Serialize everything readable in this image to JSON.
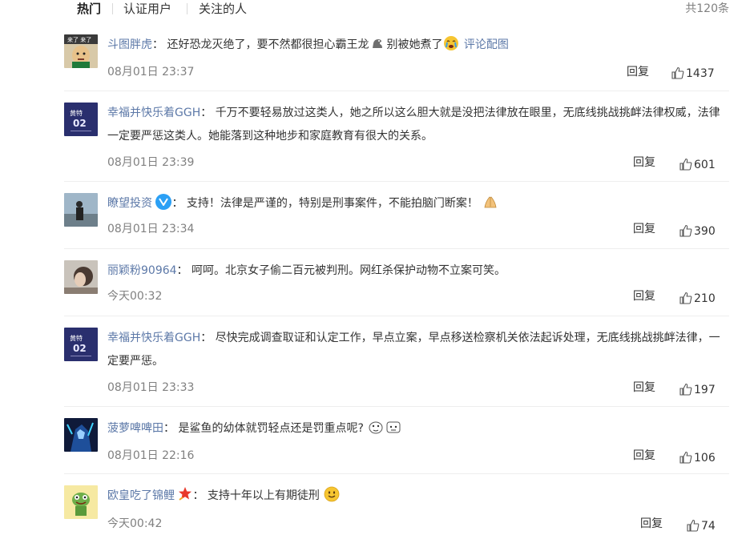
{
  "tabs": [
    {
      "label": "热门"
    },
    {
      "label": "认证用户"
    },
    {
      "label": "关注的人"
    }
  ],
  "total_count": "共120条",
  "reply_label": "回复",
  "comments": [
    {
      "user": "斗图胖虎",
      "colon": "：",
      "text": "还好恐龙灭绝了，要不然都很担心霸王龙",
      "text2": "别被她煮了",
      "extra_link": "评论配图",
      "time": "08月01日 23:37",
      "likes": "1437"
    },
    {
      "user": "幸福并快乐着GGH",
      "colon": "：",
      "text": "千万不要轻易放过这类人，她之所以这么胆大就是没把法律放在眼里，无底线挑战挑衅法律权威，法律一定要严惩这类人。她能落到这种地步和家庭教育有很大的关系。",
      "time": "08月01日 23:39",
      "likes": "601"
    },
    {
      "user": "瞭望投资",
      "colon": "：",
      "text": "支持！法律是严谨的，特别是刑事案件，不能拍脑门断案！",
      "time": "08月01日 23:34",
      "likes": "390"
    },
    {
      "user": "丽颖粉90964",
      "colon": "：",
      "text": "呵呵。北京女子偷二百元被判刑。网红杀保护动物不立案可笑。",
      "time": "今天00:32",
      "likes": "210"
    },
    {
      "user": "幸福并快乐着GGH",
      "colon": "：",
      "text": "尽快完成调查取证和认定工作，早点立案，早点移送检察机关依法起诉处理，无底线挑战挑衅法律，一定要严惩。",
      "time": "08月01日 23:33",
      "likes": "197"
    },
    {
      "user": "菠萝啤啤田",
      "colon": "：",
      "text": "是鲨鱼的幼体就罚轻点还是罚重点呢?",
      "time": "08月01日 22:16",
      "likes": "106"
    },
    {
      "user": "欧皇吃了锦鲤",
      "colon": "：",
      "text": "支持十年以上有期徒刑",
      "time": "今天00:42",
      "likes": "74"
    }
  ],
  "colors": {
    "username": "#5d79a8",
    "meta": "#808080",
    "text": "#333333",
    "verified": "#2ba0f5",
    "star_badge": "#e8392b"
  }
}
